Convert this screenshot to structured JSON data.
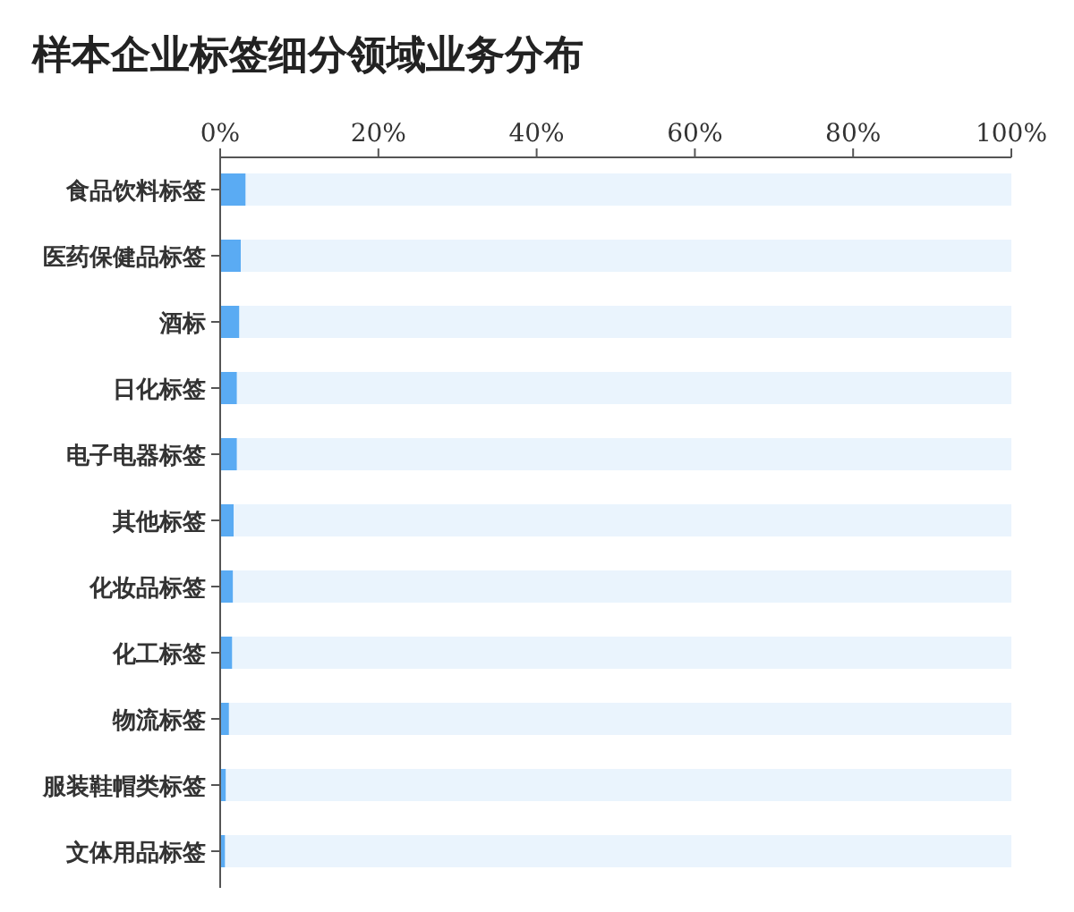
{
  "title": "样本企业标签细分领域业务分布",
  "chart_data": {
    "type": "bar",
    "orientation": "horizontal",
    "categories": [
      "食品饮料标签",
      "医药保健品标签",
      "酒标",
      "日化标签",
      "电子电器标签",
      "其他标签",
      "化妆品标签",
      "化工标签",
      "物流标签",
      "服装鞋帽类标签",
      "文体用品标签"
    ],
    "series": [
      {
        "color": "#5aabf3",
        "values": [
          3.2,
          2.6,
          2.4,
          2.1,
          2.1,
          1.7,
          1.6,
          1.5,
          1.1,
          0.7,
          0.6
        ]
      }
    ],
    "xlim": [
      0,
      100
    ],
    "xticks": [
      {
        "value": 0,
        "label": "0%"
      },
      {
        "value": 20,
        "label": "20%"
      },
      {
        "value": 40,
        "label": "40%"
      },
      {
        "value": 60,
        "label": "60%"
      },
      {
        "value": 80,
        "label": "80%"
      },
      {
        "value": 100,
        "label": "100%"
      }
    ]
  }
}
